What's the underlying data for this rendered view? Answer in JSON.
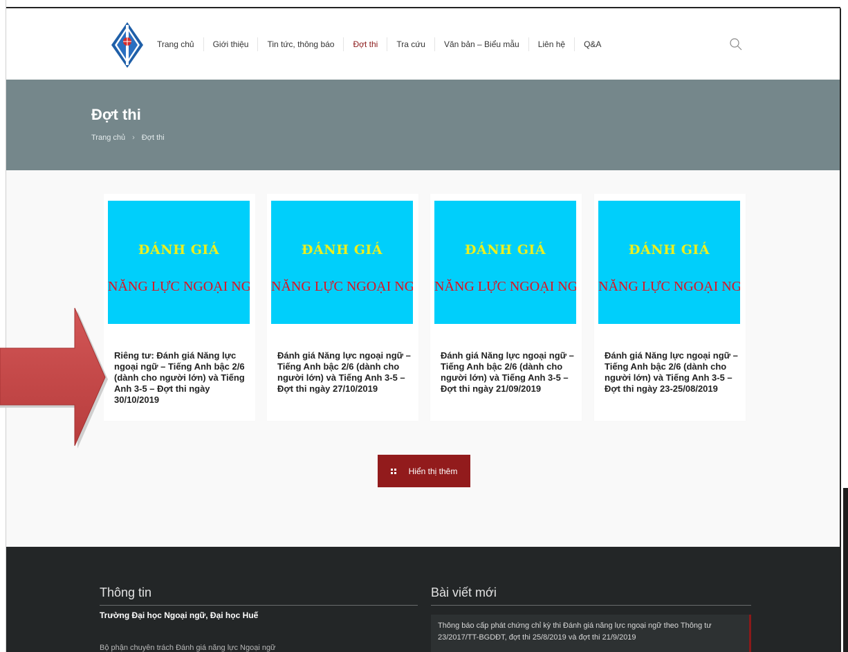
{
  "header": {
    "nav": [
      {
        "label": "Trang chủ",
        "active": false
      },
      {
        "label": "Giới thiệu",
        "active": false
      },
      {
        "label": "Tin tức, thông báo",
        "active": false
      },
      {
        "label": "Đợt thi",
        "active": true
      },
      {
        "label": "Tra cứu",
        "active": false
      },
      {
        "label": "Văn bản – Biểu mẫu",
        "active": false
      },
      {
        "label": "Liên hệ",
        "active": false
      },
      {
        "label": "Q&A",
        "active": false
      }
    ],
    "search_icon": "search-icon",
    "active_color": "#8b1a1a"
  },
  "title_band": {
    "title": "Đợt thi",
    "breadcrumb": {
      "home": "Trang chủ",
      "separator": "›",
      "current": "Đợt thi"
    },
    "background": "#75878b"
  },
  "cards": [
    {
      "thumb_line1": "ĐÁNH GIÁ",
      "thumb_line2": "NĂNG LỰC NGOẠI NGỮ",
      "title": "Riêng tư: Đánh giá Năng lực ngoại ngữ – Tiếng Anh bậc 2/6 (dành cho người lớn) và Tiếng Anh 3-5 – Đợt thi ngày 30/10/2019"
    },
    {
      "thumb_line1": "ĐÁNH GIÁ",
      "thumb_line2": "NĂNG LỰC NGOẠI NGỮ",
      "title": "Đánh giá Năng lực ngoại ngữ – Tiếng Anh bậc 2/6 (dành cho người lớn) và Tiếng Anh 3-5 – Đợt thi ngày 27/10/2019"
    },
    {
      "thumb_line1": "ĐÁNH GIÁ",
      "thumb_line2": "NĂNG LỰC NGOẠI NGỮ",
      "title": "Đánh giá Năng lực ngoại ngữ – Tiếng Anh bậc 2/6 (dành cho người lớn) và Tiếng Anh 3-5 – Đợt thi ngày 21/09/2019"
    },
    {
      "thumb_line1": "ĐÁNH GIÁ",
      "thumb_line2": "NĂNG LỰC NGOẠI NGỮ",
      "title": "Đánh giá Năng lực ngoại ngữ – Tiếng Anh bậc 2/6 (dành cho người lớn) và Tiếng Anh 3-5 – Đợt thi ngày 23-25/08/2019"
    }
  ],
  "colors": {
    "thumb_bg": "#00cffb",
    "thumb_line1": "#ecef1e",
    "thumb_line2": "#e0121f",
    "button_bg": "#921b1c",
    "footer_bg": "#232627",
    "arrow": "#c84b4b"
  },
  "more_button": {
    "label": "Hiển thị thêm",
    "icon": "grid-icon"
  },
  "footer": {
    "info_title": "Thông tin",
    "info_org": "Trường Đại học Ngoại ngữ, Đại học Huế",
    "info_line": "Bộ phận chuyên trách Đánh giá năng lực Ngoại ngữ",
    "news_title": "Bài viết mới",
    "news_item": "Thông báo cấp phát chứng chỉ kỳ thi Đánh giá năng lực ngoại ngữ theo Thông tư 23/2017/TT-BGDĐT, đợt thi 25/8/2019 và đợt thi 21/9/2019"
  }
}
